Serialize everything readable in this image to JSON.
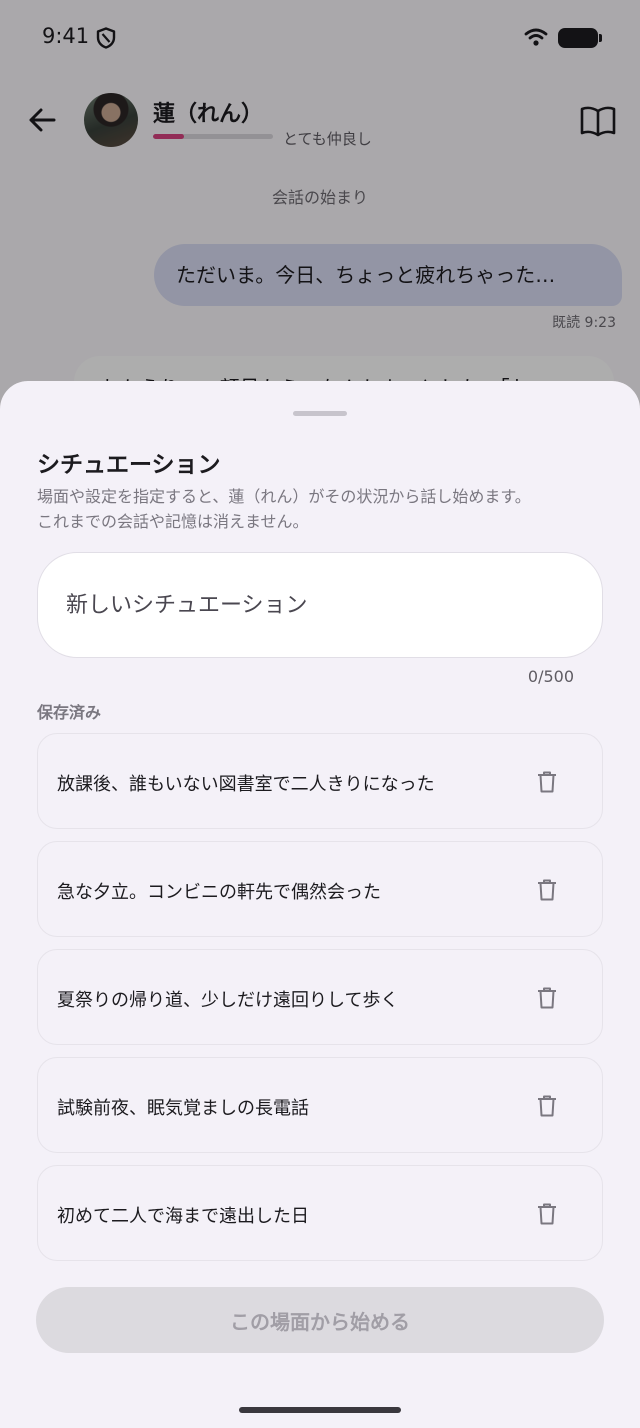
{
  "status_bar": {
    "time": "9:41"
  },
  "app_bar": {
    "character_name": "蓮（れん）",
    "affinity_label": "とても仲良し",
    "affinity_level": 0.26,
    "affinity_color": "#d8417f",
    "icons": {
      "back": "arrow-left-icon",
      "book": "open-book-icon"
    }
  },
  "chat": {
    "start_label": "会話の始まり",
    "messages": [
      {
        "role": "user",
        "text": "ただいま。今日、ちょっと疲れちゃった…",
        "read_label": "既読",
        "time": "9:23"
      },
      {
        "role": "ai",
        "text": "おかえり。…顔見たら、なんかホッとした。「お"
      }
    ]
  },
  "sheet": {
    "title": "シチュエーション",
    "description": [
      "場面や設定を指定すると、蓮（れん）がその状況から話し始めます。",
      "これまでの会話や記憶は消えません。"
    ],
    "input": {
      "placeholder": "新しいシチュエーション",
      "value": "",
      "counter": "0/500"
    },
    "saved_label": "保存済み",
    "saved": [
      {
        "text": "放課後、誰もいない図書室で二人きりになった"
      },
      {
        "text": "急な夕立。コンビニの軒先で偶然会った"
      },
      {
        "text": "夏祭りの帰り道、少しだけ遠回りして歩く"
      },
      {
        "text": "試験前夜、眠気覚ましの長電話"
      },
      {
        "text": "初めて二人で海まで遠出した日"
      }
    ],
    "start_button": "この場面から始める"
  }
}
